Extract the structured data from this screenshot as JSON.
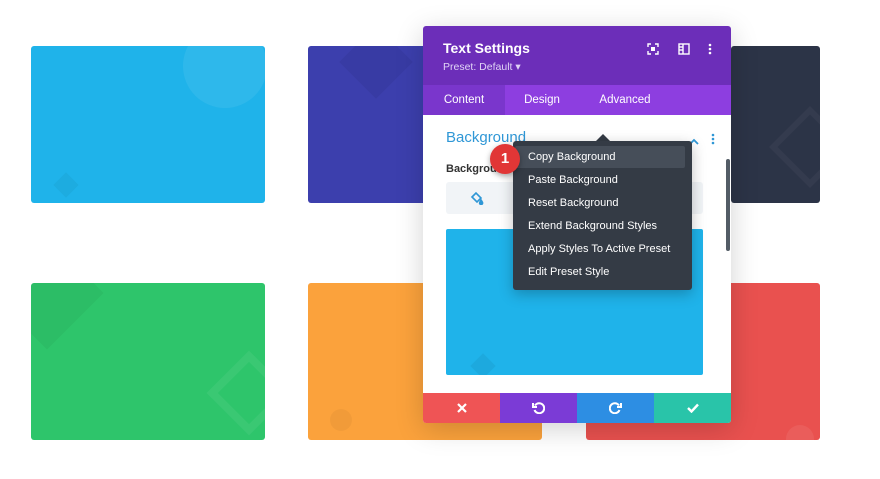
{
  "colors": {
    "card_blue": "#1fb3ea",
    "card_indigo": "#3c3fad",
    "card_navy": "#2c3447",
    "card_green": "#2ec56b",
    "card_orange": "#fba23c",
    "card_red": "#e9514f",
    "header": "#6c2eb9",
    "tabs": "#8d3ee0",
    "accent": "#2f97d6",
    "menu": "#343b45",
    "badge": "#e13636"
  },
  "modal": {
    "title": "Text Settings",
    "preset": "Preset: Default ▾",
    "header_icons": [
      "focus-icon",
      "columns-icon",
      "more-vertical-icon"
    ],
    "tabs": [
      {
        "label": "Content",
        "active": true
      },
      {
        "label": "Design",
        "active": false
      },
      {
        "label": "Advanced",
        "active": false
      }
    ],
    "section_title": "Background",
    "background_label": "Backgrou",
    "footer_buttons": [
      "close-icon",
      "undo-icon",
      "redo-icon",
      "check-icon"
    ]
  },
  "context_menu": {
    "items": [
      "Copy Background",
      "Paste Background",
      "Reset Background",
      "Extend Background Styles",
      "Apply Styles To Active Preset",
      "Edit Preset Style"
    ],
    "highlighted_index": 0
  },
  "badge": {
    "number": "1"
  }
}
